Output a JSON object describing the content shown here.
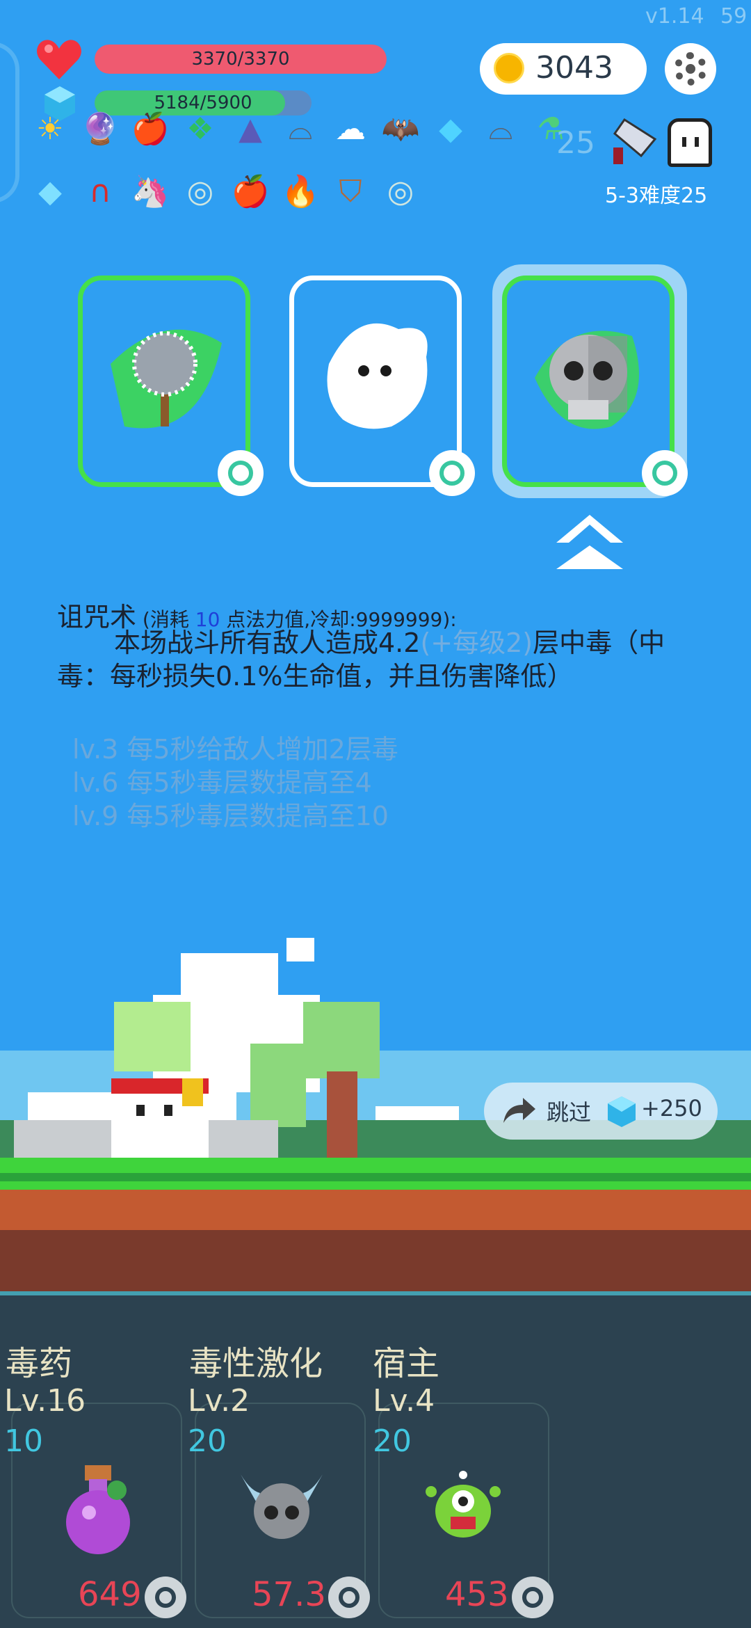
{
  "hud": {
    "version": "v1.14",
    "fps": "59",
    "hp_text": "3370/3370",
    "hp_fraction": 1.0,
    "mp_text": "5184/5900",
    "mp_fraction": 0.879,
    "gold": "3043",
    "faded_number": "25",
    "stage_label": "5-3难度25"
  },
  "items_row1": [
    "sun-orb-icon",
    "crystal-ball-icon",
    "apple-icon",
    "emerald-icon",
    "wizard-hat-icon",
    "mortar-icon",
    "wing-icon",
    "bat-icon",
    "blue-gem-icon",
    "mortar-icon",
    "green-potion-icon"
  ],
  "items_row2": [
    "diamond-icon",
    "magnet-icon",
    "unicorn-icon",
    "shield-ring-icon",
    "apple-icon",
    "torch-icon",
    "wooden-shield-icon",
    "shield-ring-icon"
  ],
  "skills": [
    {
      "name": "mace-skill",
      "style": "green"
    },
    {
      "name": "ghost-skill",
      "style": "white"
    },
    {
      "name": "skull-skill",
      "style": "green-selected"
    }
  ],
  "description": {
    "title": "诅咒术",
    "cost_prefix": " (消耗 ",
    "mana_cost": "10",
    "cost_suffix": " 点法力值,冷却:9999999):",
    "body_a": "本场战斗所有敌人造成4.2",
    "body_dim": "(+每级2)",
    "body_b": "层中毒（中毒：每秒损失0.1%生命值，并且伤害降低）",
    "levels": [
      "lv.3 每5秒给敌人增加2层毒",
      "lv.6 每5秒毒层数提高至4",
      "lv.9 每5秒毒层数提高至10"
    ]
  },
  "skip": {
    "label": "跳过",
    "reward": "+250"
  },
  "upgrades": [
    {
      "name": "毒药",
      "level": "Lv.16",
      "cost": "10",
      "value": "649"
    },
    {
      "name": "毒性激化",
      "level": "Lv.2",
      "cost": "20",
      "value": "57.3"
    },
    {
      "name": "宿主",
      "level": "Lv.4",
      "cost": "20",
      "value": "453"
    }
  ],
  "colors": {
    "sky": "#2f9ff2",
    "hp": "#ef5a70",
    "mp": "#3fc777",
    "panel": "#2c4250",
    "accent_green": "#46e04a",
    "cost_cyan": "#41c7e0",
    "value_red": "#e84556"
  }
}
